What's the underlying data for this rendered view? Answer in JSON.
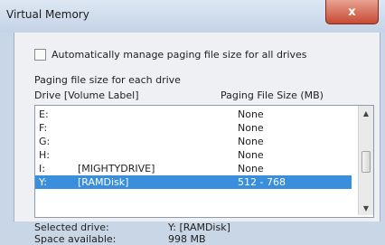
{
  "window": {
    "title": "Virtual Memory",
    "close_glyph": "x"
  },
  "auto_manage": {
    "label": "Automatically manage paging file size for all drives",
    "checked": false
  },
  "paging_group": {
    "label": "Paging file size for each drive",
    "col_drive": "Drive  [Volume Label]",
    "col_size": "Paging File Size (MB)"
  },
  "drives": [
    {
      "drive": "E:",
      "label": "",
      "size": "None"
    },
    {
      "drive": "F:",
      "label": "",
      "size": "None"
    },
    {
      "drive": "G:",
      "label": "",
      "size": "None"
    },
    {
      "drive": "H:",
      "label": "",
      "size": "None"
    },
    {
      "drive": "I:",
      "label": "[MIGHTYDRIVE]",
      "size": "None"
    },
    {
      "drive": "Y:",
      "label": "[RAMDisk]",
      "size": "512 - 768",
      "selected": true
    }
  ],
  "selected_drive": {
    "label": "Selected drive:",
    "value": "Y:  [RAMDisk]"
  },
  "space_available": {
    "label": "Space available:",
    "value": "998 MB"
  },
  "icons": {
    "up": "scroll-up-arrow",
    "down": "scroll-down-arrow"
  }
}
